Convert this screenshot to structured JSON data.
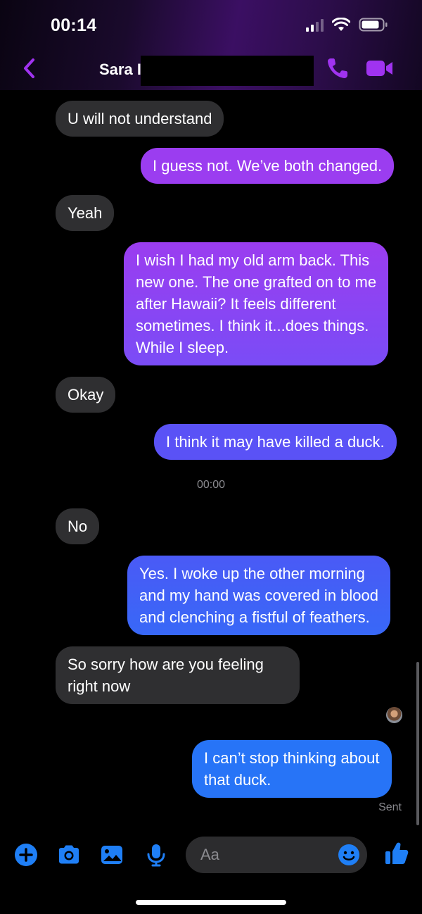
{
  "status_bar": {
    "time": "00:14"
  },
  "header": {
    "contact_name": "Sara I"
  },
  "messages": [
    {
      "direction": "in",
      "text": "U will not understand"
    },
    {
      "direction": "out",
      "text": "I guess not. We’ve both changed."
    },
    {
      "direction": "in",
      "text": "Yeah"
    },
    {
      "direction": "out",
      "lines": [
        "I wish I had my old arm back. This",
        "new one. The one grafted on to me",
        "after Hawaii? It feels different",
        "sometimes. I think it...does things.",
        "While I sleep."
      ]
    },
    {
      "direction": "in",
      "text": "Okay"
    },
    {
      "direction": "out",
      "text": "I think it may have killed a duck."
    },
    {
      "direction": "in",
      "text": "No"
    },
    {
      "direction": "out",
      "lines": [
        "Yes. I woke up the other morning",
        "and my hand was covered in blood",
        "and clenching a fistful of feathers."
      ]
    },
    {
      "direction": "in",
      "lines": [
        "So  sorry how are you feeling",
        "right now"
      ]
    },
    {
      "direction": "out",
      "lines": [
        "I can’t stop thinking about",
        "that duck."
      ]
    }
  ],
  "timestamp": "00:00",
  "delivery_status": "Sent",
  "composer": {
    "placeholder": "Aa"
  },
  "colors": {
    "accent": "#a033f0",
    "incoming_bubble": "#2f2f31",
    "gradient_top": "#9b3df0",
    "gradient_bottom": "#1f6ff5",
    "composer_icons": "#1f7ff6"
  },
  "icons": [
    "chevron-left-icon",
    "phone-icon",
    "video-camera-icon",
    "plus-icon",
    "camera-icon",
    "image-icon",
    "microphone-icon",
    "emoji-icon",
    "thumbs-up-icon"
  ]
}
